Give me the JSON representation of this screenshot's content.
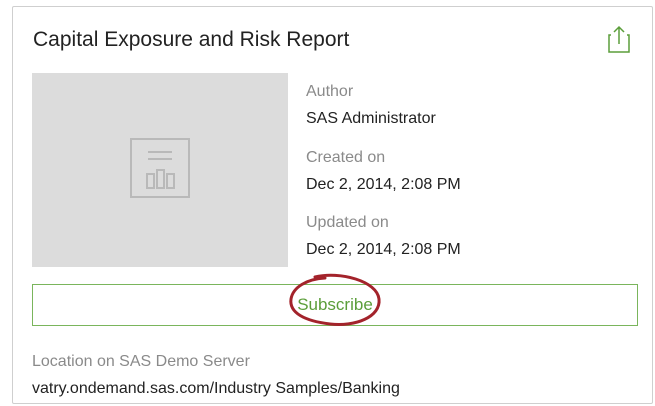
{
  "report": {
    "title": "Capital Exposure and Risk Report",
    "author_label": "Author",
    "author": "SAS Administrator",
    "created_label": "Created on",
    "created": "Dec 2, 2014, 2:08 PM",
    "updated_label": "Updated on",
    "updated": "Dec 2, 2014, 2:08 PM",
    "subscribe_label": "Subscribe",
    "location_label": "Location on SAS Demo Server",
    "location": "vatry.ondemand.sas.com/Industry Samples/Banking"
  },
  "icons": {
    "share": "share-icon",
    "thumbnail": "report-chart-icon"
  },
  "colors": {
    "accent": "#5b9e3a",
    "annotation": "#a3232b"
  }
}
